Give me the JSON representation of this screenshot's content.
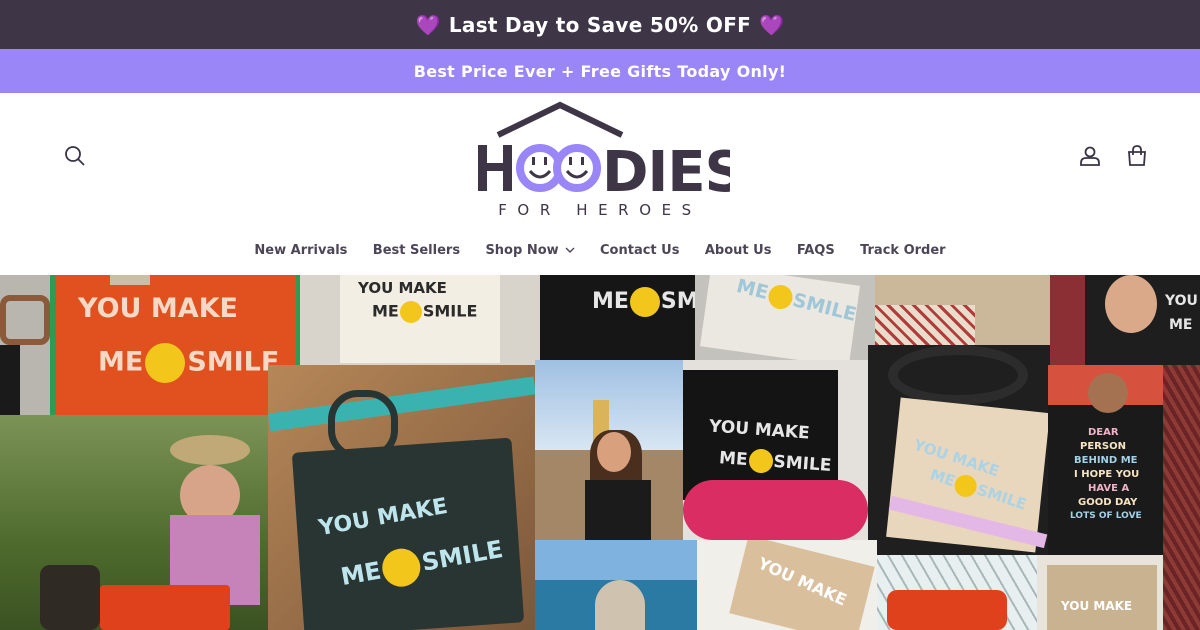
{
  "announcement": {
    "top_text": "Last Day to Save 50% OFF",
    "heart_left": "💜",
    "heart_right": "💜",
    "bottom_text": "Best Price Ever + Free Gifts Today Only!"
  },
  "header": {
    "logo_text": "HOODIES",
    "logo_sub": "FOR HEROES"
  },
  "nav": {
    "items": [
      {
        "label": "New Arrivals"
      },
      {
        "label": "Best Sellers"
      },
      {
        "label": "Shop Now"
      },
      {
        "label": "Contact Us"
      },
      {
        "label": "About Us"
      },
      {
        "label": "FAQS"
      },
      {
        "label": "Track Order"
      }
    ]
  },
  "hero": {
    "bag_texts": {
      "orange_line1": "YOU MAKE",
      "orange_line2a": "ME",
      "orange_line2b": "SMILE",
      "cream_line1": "YOU MAKE",
      "cream_line2a": "ME",
      "cream_line2b": "SMILE",
      "black_top_a": "ME",
      "black_top_b": "SMIL",
      "white_top_a": "ME",
      "white_top_b": "SMILE",
      "right_top_line1": "YOU",
      "right_top_line2": "ME",
      "center_line1": "YOU MAKE",
      "center_line2a": "ME",
      "center_line2b": "SMILE",
      "black2_line1": "YOU MAKE",
      "black2_line2a": "ME",
      "black2_line2b": "SMILE",
      "beige_line1": "YOU MAKE",
      "beige_line2a": "ME",
      "beige_line2b": "SMILE",
      "hoodie_line1": "DEAR",
      "hoodie_line2": "PERSON",
      "hoodie_line3": "BEHIND ME",
      "hoodie_line4": "I HOPE YOU",
      "hoodie_line5": "HAVE A",
      "hoodie_line6": "GOOD DAY",
      "hoodie_line7": "LOTS OF LOVE",
      "bottom_bag1": "YOU MAKE",
      "bottom_bag2": "YOU MAKE"
    }
  },
  "colors": {
    "announce_top_bg": "#3e3546",
    "announce_bottom_bg": "#9a86f6",
    "brand_dark": "#3e3546",
    "brand_purple": "#9a86f6"
  }
}
